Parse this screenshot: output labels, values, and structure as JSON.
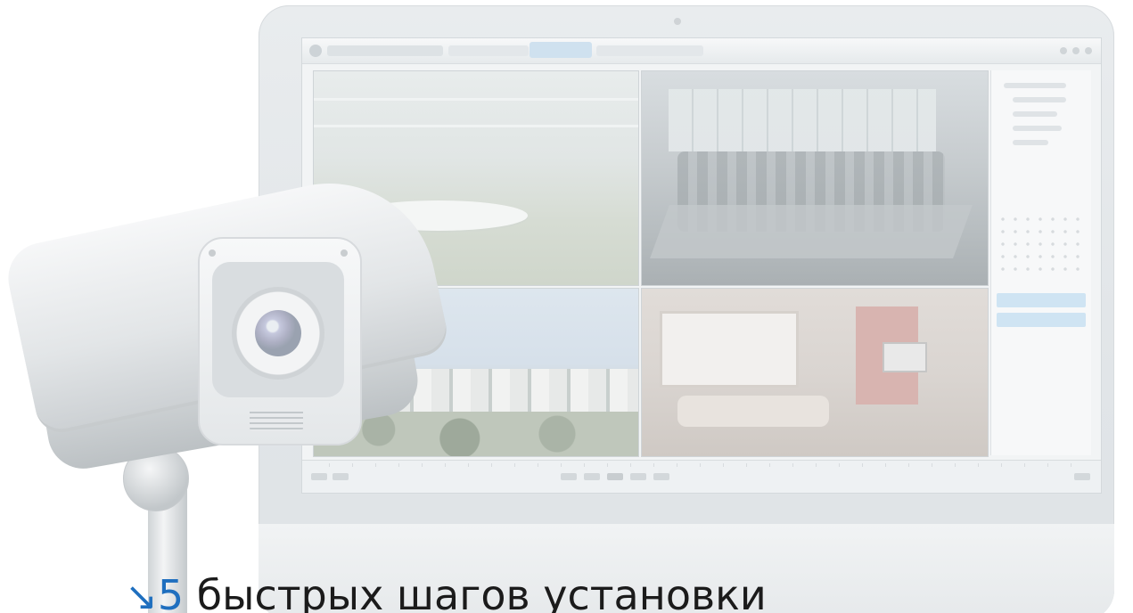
{
  "headline": {
    "arrow_glyph": "↘",
    "number": "5",
    "text": "быстрых шагов установки"
  },
  "colors": {
    "accent": "#1f6fbf",
    "text": "#1b1b1b",
    "background": "#ffffff"
  },
  "icons": [
    "cctv-camera-icon",
    "monitor-icon",
    "arrow-down-right-icon"
  ]
}
